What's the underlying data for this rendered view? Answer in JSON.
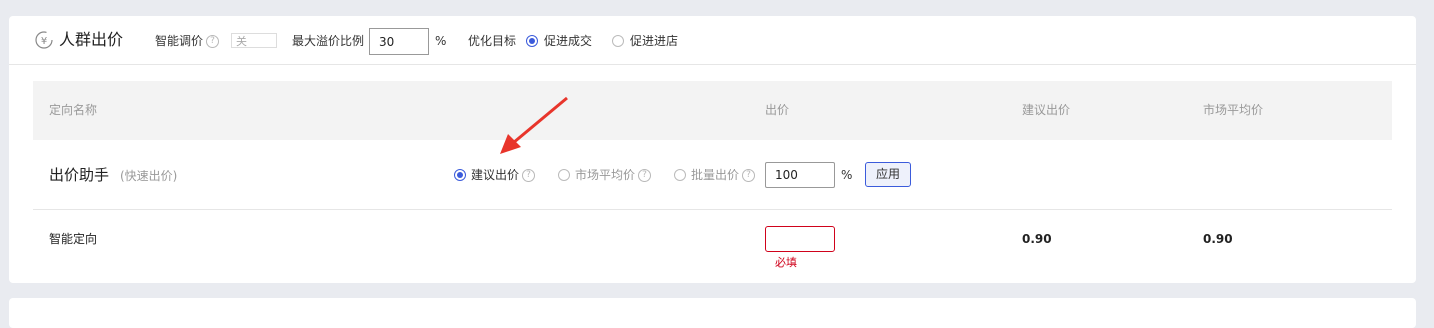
{
  "header": {
    "title": "人群出价",
    "smart_adjust_label": "智能调价",
    "smart_adjust_value": "关",
    "max_premium_label": "最大溢价比例",
    "max_premium_value": "30",
    "percent": "%",
    "optimize_label": "优化目标",
    "optimize_options": [
      {
        "label": "促进成交",
        "selected": true
      },
      {
        "label": "促进进店",
        "selected": false
      }
    ]
  },
  "table": {
    "columns": [
      "定向名称",
      "出价",
      "建议出价",
      "市场平均价"
    ],
    "assistant": {
      "title": "出价助手",
      "subtitle": "(快速出价)",
      "options": [
        {
          "label": "建议出价",
          "selected": true
        },
        {
          "label": "市场平均价",
          "selected": false
        },
        {
          "label": "批量出价",
          "selected": false
        }
      ],
      "value": "100",
      "percent": "%",
      "apply_label": "应用"
    },
    "rows": [
      {
        "name": "智能定向",
        "bid_value": "",
        "bid_error": "必填",
        "suggested": "0.90",
        "market_avg": "0.90"
      }
    ]
  },
  "colors": {
    "accent": "#3b5bdb",
    "error": "#d0021b",
    "annotation_arrow": "#e8352b"
  }
}
